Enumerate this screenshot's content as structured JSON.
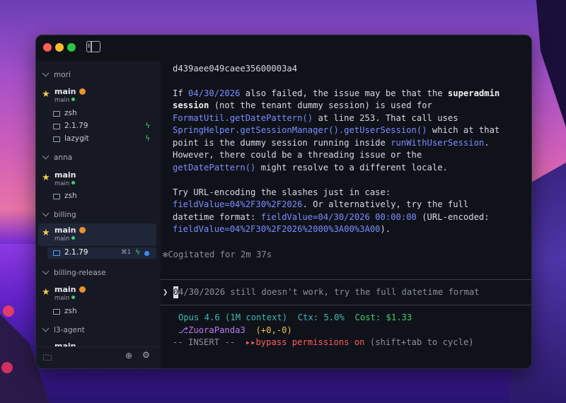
{
  "sidebar": {
    "groups": [
      {
        "name": "mori"
      },
      {
        "name": "anna"
      },
      {
        "name": "billing"
      },
      {
        "name": "billing-release"
      },
      {
        "name": "l3-agent"
      }
    ],
    "mori": {
      "ws_title": "main",
      "ws_branch": "main",
      "terminals": [
        "zsh",
        "2.1.79",
        "lazygit"
      ]
    },
    "anna": {
      "ws_title": "main",
      "ws_branch": "main",
      "terminals": [
        "zsh"
      ]
    },
    "billing": {
      "ws_title": "main",
      "ws_branch": "main",
      "terminal": "2.1.79",
      "shortcut": "⌘1"
    },
    "billing_release": {
      "ws_title": "main",
      "ws_branch": "main",
      "terminals": [
        "zsh"
      ]
    },
    "l3_agent": {
      "ws_title": "main"
    }
  },
  "terminal": {
    "hash": "d439aee049caee35600003a4",
    "p1": {
      "a": "If ",
      "date": "04/30/2026",
      "b": " also failed, the issue may be that the ",
      "c": "superadmin",
      "d": "session",
      "e": " (not the tenant dummy session) is used for",
      "f": "FormatUtil.getDatePattern()",
      "g": " at line 253. That call uses",
      "h": "SpringHelper.getSessionManager().getUserSession()",
      "i": " which at that",
      "j": "point is the dummy session running inside ",
      "k": "runWithUserSession",
      "l": ".",
      "m": "However, there could be a threading issue or the",
      "n": "getDatePattern()",
      "o": " might resolve to a different locale."
    },
    "p2": {
      "a": "Try URL-encoding the slashes just in case:",
      "b": "fieldValue=04%2F30%2F2026",
      "c": ". Or alternatively, try the full",
      "d": "datetime format: ",
      "e": "fieldValue=04/30/2026 00:00:00",
      "f": " (URL-encoded:",
      "g": "fieldValue=04%2F30%2F2026%2000%3A00%3A00",
      "h": ")."
    },
    "cogitated": "✻Cogitated for 2m 37s",
    "prompt_symbol": "❯",
    "cursor_char": "0",
    "prompt_text": "4/30/2026 still doesn't work, try the full datetime format",
    "status": {
      "model": "Opus 4.6 (1M context)",
      "ctx": "Ctx: 5.0%",
      "cost": "Cost: $1.33",
      "branch": "⎇ZuoraPanda3",
      "diff": "(+0,-0)",
      "mode": "-- INSERT --",
      "perm_icon": "▸▸",
      "perm": "bypass permissions on",
      "perm_hint": "(shift+tab to cycle)"
    }
  },
  "colors": {
    "accent_link": "#7b8cff",
    "status_teal": "#3fb8b0",
    "status_green": "#3ecf6b",
    "status_yellow": "#e5c24a",
    "permission_red": "#ff5c5c"
  }
}
